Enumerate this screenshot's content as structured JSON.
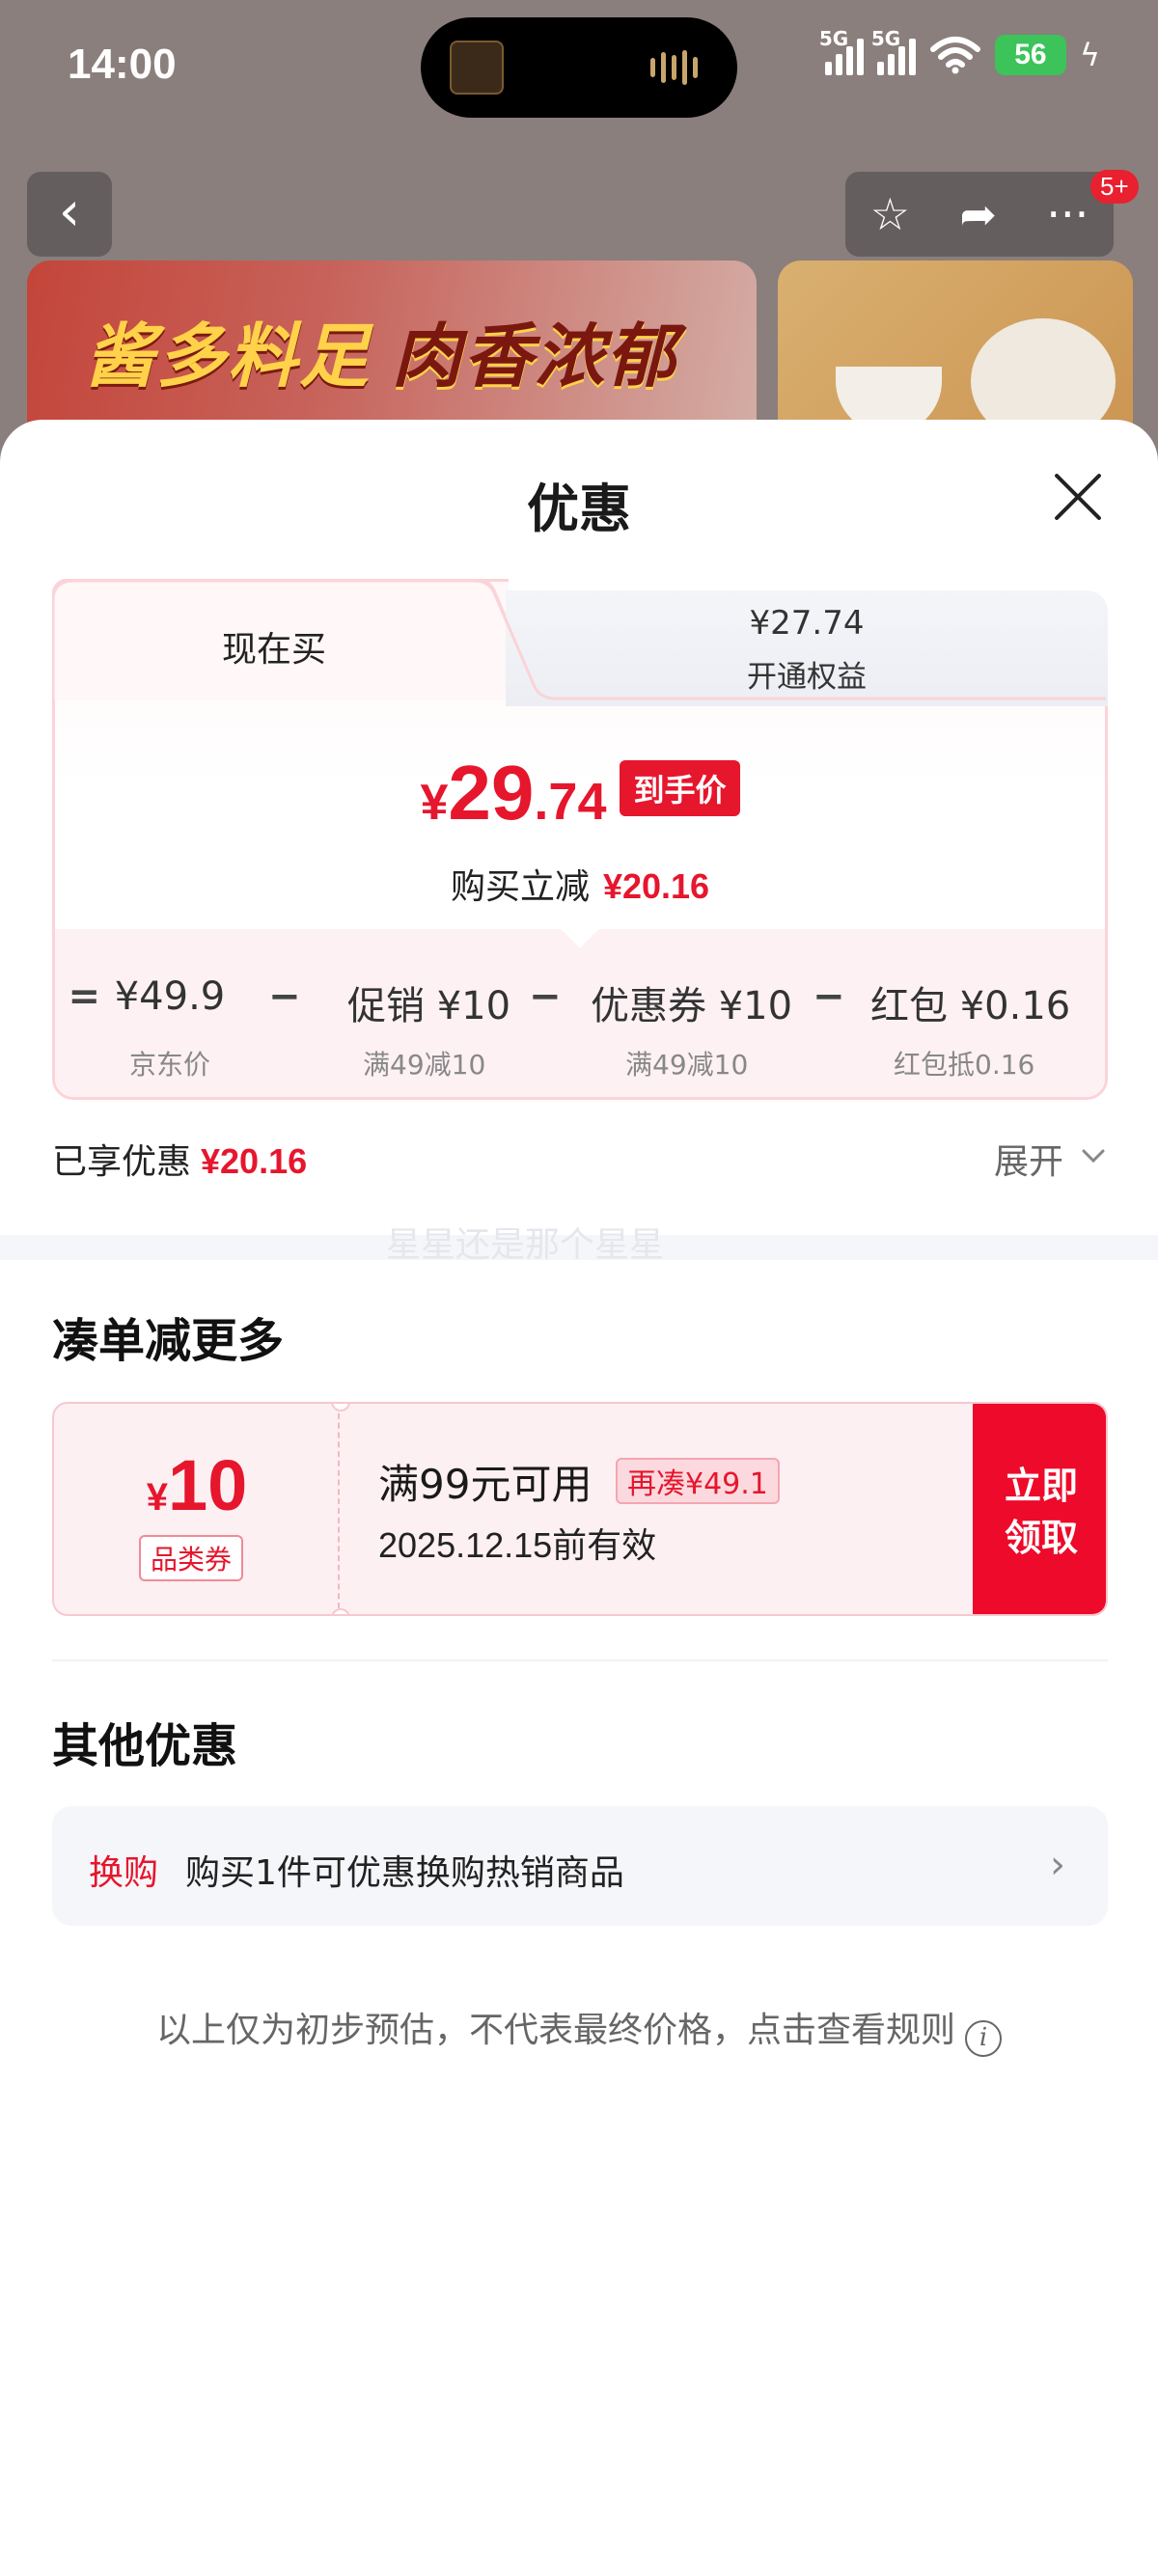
{
  "status_bar": {
    "time": "14:00",
    "battery": "56",
    "sig1": "5G",
    "sig2": "5G"
  },
  "background": {
    "banner_text_1": "酱多料足",
    "banner_text_2": "肉香浓郁",
    "notification_badge": "5+"
  },
  "sheet": {
    "title": "优惠",
    "tabs": {
      "buy_now": "现在买",
      "member_price": "¥27.74",
      "member_label": "开通权益"
    },
    "final": {
      "yen": "¥",
      "integer": "29",
      "decimal": ".74",
      "tag": "到手价",
      "reduce_label": "购买立减",
      "reduce_value": "¥20.16"
    },
    "formula": {
      "eq": "=",
      "jd_price": "¥49.9",
      "jd_price_label": "京东价",
      "promo": "促销 ¥10",
      "promo_label": "满49减10",
      "coupon": "优惠券 ¥10",
      "coupon_label": "满49减10",
      "redpack": "红包 ¥0.16",
      "redpack_label": "红包抵0.16",
      "minus": "−"
    },
    "enjoyed_label": "已享优惠",
    "enjoyed_value": "¥20.16",
    "expand_label": "展开",
    "watermark": "星星还是那个星星"
  },
  "more_section": {
    "title": "凑单减更多",
    "coupon": {
      "yen": "¥",
      "amount": "10",
      "type": "品类券",
      "condition": "满99元可用",
      "more": "再凑¥49.1",
      "valid": "2025.12.15前有效",
      "button_line1": "立即",
      "button_line2": "领取"
    }
  },
  "other_section": {
    "title": "其他优惠",
    "exchange_tag": "换购",
    "exchange_text": "购买1件可优惠换购热销商品"
  },
  "disclaimer": "以上仅为初步预估，不代表最终价格，点击查看规则",
  "colors": {
    "accent": "#e6162d",
    "coupon_button": "#ee0a2a",
    "battery": "#3cc35a"
  }
}
